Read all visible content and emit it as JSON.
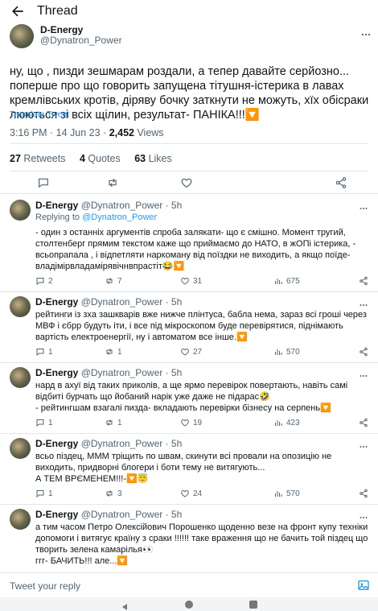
{
  "header": {
    "title": "Thread"
  },
  "main_tweet": {
    "name": "D-Energy",
    "handle": "@Dynatron_Power",
    "text": "ну, що , пизди зешмарам роздали, а тепер давайте серйозно... поперше про що говорить запущена тітушня-істерика в лавах кремлівських кротів, діряву бочку заткнути не можуть, хїх обісраки люються зі всіх щілин, результат- ПАНІКА!!!🔽",
    "translate_label": "Translate Tweet",
    "time": "3:16 PM · 14 Jun 23 · ",
    "views_count": "2,452",
    "views_label": " Views",
    "retweets_count": "27",
    "retweets_label": " Retweets",
    "quotes_count": "4",
    "quotes_label": " Quotes",
    "likes_count": "63",
    "likes_label": " Likes"
  },
  "replies": [
    {
      "name": "D-Energy",
      "handle": "@Dynatron_Power · 5h",
      "replying_prefix": "Replying to ",
      "replying_to": "@Dynatron_Power",
      "text": "- один з останніх аргументів спроба залякати- що є смішно. Момент тругий, столтенберг прямим текстом каже що приймаємо до НАТО, в жОПі істерика, - всьопрапала , і відпетляти наркоману від поїздки не виходить, а якщо поїде- владімірвладамірявічнвпрастіт😂🔽",
      "replies": "2",
      "retweets": "7",
      "likes": "31",
      "views": "675"
    },
    {
      "name": "D-Energy",
      "handle": "@Dynatron_Power · 5h",
      "text": "рейтинги із зха зашкварів вже нижче плінтуса, бабла нема, зараз всі гроші через МВФ і єбрр будуть іти, і все під мікроскопом буде перевірятися, піднімають вартість електроенергії, ну і автоматом все інше.🔽",
      "replies": "1",
      "retweets": "1",
      "likes": "27",
      "views": "570"
    },
    {
      "name": "D-Energy",
      "handle": "@Dynatron_Power · 5h",
      "text": "нард в ахуї від таких приколів, а ще ярмо перевірок повертають, навіть самі відбиті бурчать що йобаний нарік уже даже не підарас🤣\n- рейтингшам взагалі пизда- вкладають перевірки бізнесу на серпень🔽",
      "replies": "1",
      "retweets": "1",
      "likes": "19",
      "views": "423"
    },
    {
      "name": "D-Energy",
      "handle": "@Dynatron_Power · 5h",
      "text": "всьо піздец, МММ тріщить по швам, скинути всі провали на опозицію не виходить, придворні блогери і боти тему не витягують...\nА ТЕМ ВРЄМЕНЕМ!!!-🔽😇",
      "replies": "1",
      "retweets": "3",
      "likes": "24",
      "views": "570"
    },
    {
      "name": "D-Energy",
      "handle": "@Dynatron_Power · 5h",
      "text": "а тим часом Петро Олексійович Порошенко щоденно везе на фронт купу техніки допомоги і витягує країну з сраки !!!!!! таке враження що не бачить той піздец що творить зелена камарілья👀\nггг- БАЧИТЬ!!! але...🔽"
    }
  ],
  "compose": {
    "placeholder": "Tweet your reply"
  },
  "colors": {
    "accent": "#1d9bf0",
    "muted": "#536471",
    "text": "#0f1419"
  }
}
